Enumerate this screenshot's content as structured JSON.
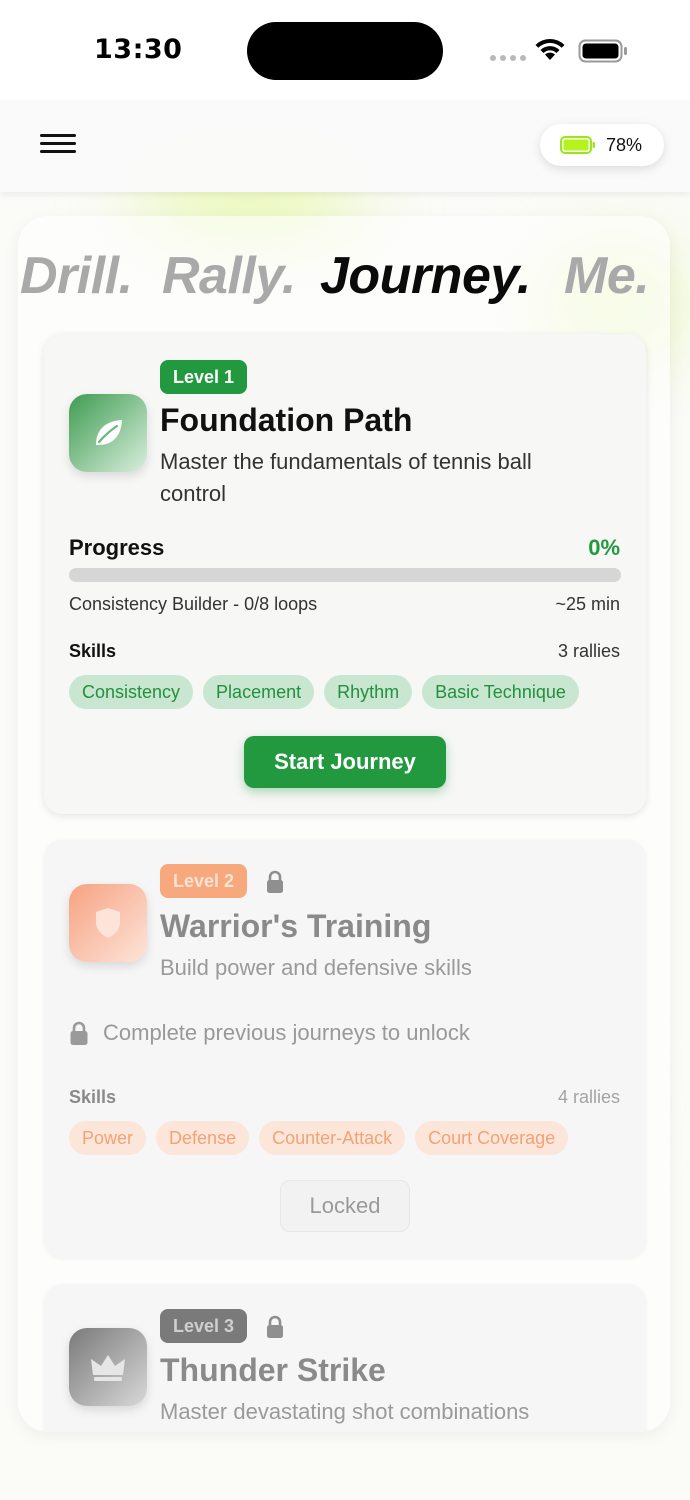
{
  "status_bar": {
    "time": "13:30"
  },
  "header": {
    "battery_percent": "78%"
  },
  "tabs": [
    {
      "label": "Drill.",
      "active": false
    },
    {
      "label": "Rally.",
      "active": false
    },
    {
      "label": "Journey.",
      "active": true
    },
    {
      "label": "Me.",
      "active": false
    }
  ],
  "journeys": [
    {
      "level": "Level 1",
      "title": "Foundation Path",
      "description": "Master the fundamentals of tennis ball control",
      "icon": "leaf-icon",
      "locked": false,
      "progress_label": "Progress",
      "progress_percent": "0%",
      "progress_fraction": 0,
      "current_step": "Consistency Builder - 0/8 loops",
      "duration": "~25 min",
      "skills_label": "Skills",
      "rally_count": "3 rallies",
      "skills": [
        "Consistency",
        "Placement",
        "Rhythm",
        "Basic Technique"
      ],
      "action_label": "Start Journey"
    },
    {
      "level": "Level 2",
      "title": "Warrior's Training",
      "description": "Build power and defensive skills",
      "icon": "shield-icon",
      "locked": true,
      "unlock_message": "Complete previous journeys to unlock",
      "skills_label": "Skills",
      "rally_count": "4 rallies",
      "skills": [
        "Power",
        "Defense",
        "Counter-Attack",
        "Court Coverage"
      ],
      "action_label": "Locked"
    },
    {
      "level": "Level 3",
      "title": "Thunder Strike",
      "description": "Master devastating shot combinations",
      "icon": "crown-icon",
      "locked": true
    }
  ],
  "colors": {
    "accent_green": "#22993f",
    "level2_orange": "#f7a87c",
    "level3_gray": "#7a7a7a",
    "battery_green": "#b6f21c"
  }
}
